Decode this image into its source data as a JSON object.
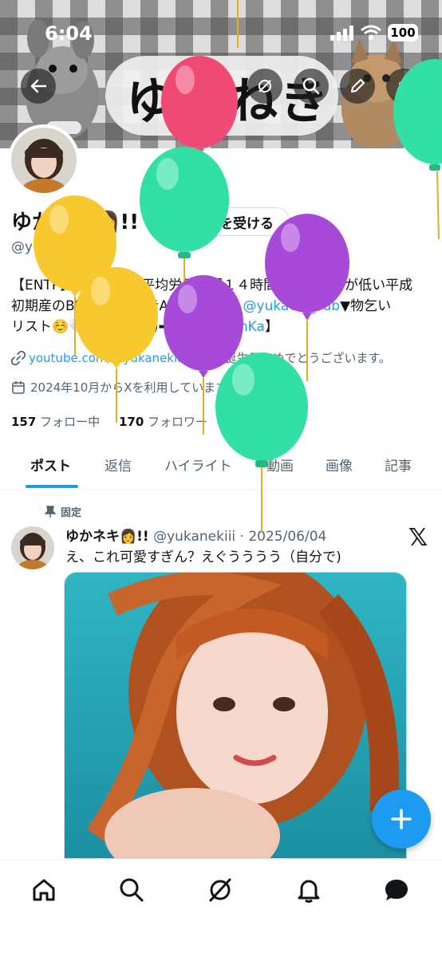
{
  "status_bar": {
    "time": "6:04",
    "battery": "100"
  },
  "banner": {
    "title": "ゆかねき"
  },
  "profile": {
    "name": "ゆかネキ👩!!",
    "verify_label": "認証を受ける",
    "handle": "@yukanekiii",
    "bio_line1": "【ENTP】仕事大好き平均労働時間１４時間の社畜。声が低い平成",
    "bio_line2_a": "初期産のBBAです👵▼#APEX🎮▼🔑 ",
    "bio_line2_link": "@yukachi_sub",
    "bio_line2_b": "▼物乞い",
    "bio_line3_a": "リスト☺️🤍（amazon)➡【",
    "bio_line3_link": "x.gd/39mKa",
    "bio_line3_b": "】",
    "website": "youtube.com/@yukanekiii",
    "birthday": "お誕生日おめでとうございます。",
    "joined": "2024年10月からXを利用しています",
    "following_count": "157",
    "following_label": "フォロー中",
    "followers_count": "170",
    "followers_label": "フォロワー"
  },
  "tabs": [
    {
      "label": "ポスト"
    },
    {
      "label": "返信"
    },
    {
      "label": "ハイライト"
    },
    {
      "label": "動画"
    },
    {
      "label": "画像"
    },
    {
      "label": "記事"
    }
  ],
  "post": {
    "pinned_label": "固定",
    "author_name": "ゆかネキ👩!!",
    "handle_date": "@yukanekiii · 2025/06/04",
    "text": "え、これ可愛すぎん？えぐうううう（自分で)"
  },
  "icons": {
    "back": "back-arrow-icon",
    "grok": "grok-icon",
    "search": "search-icon",
    "edit": "pencil-icon",
    "share": "share-icon",
    "compose": "plus-icon"
  },
  "colors": {
    "accent": "#1d9bf0",
    "text": "#0f1419",
    "secondary": "#536471",
    "balloon_pink": "#ef4a74",
    "balloon_green": "#32e0a6",
    "balloon_yellow": "#f7c92f",
    "balloon_purple": "#a84ad9"
  }
}
